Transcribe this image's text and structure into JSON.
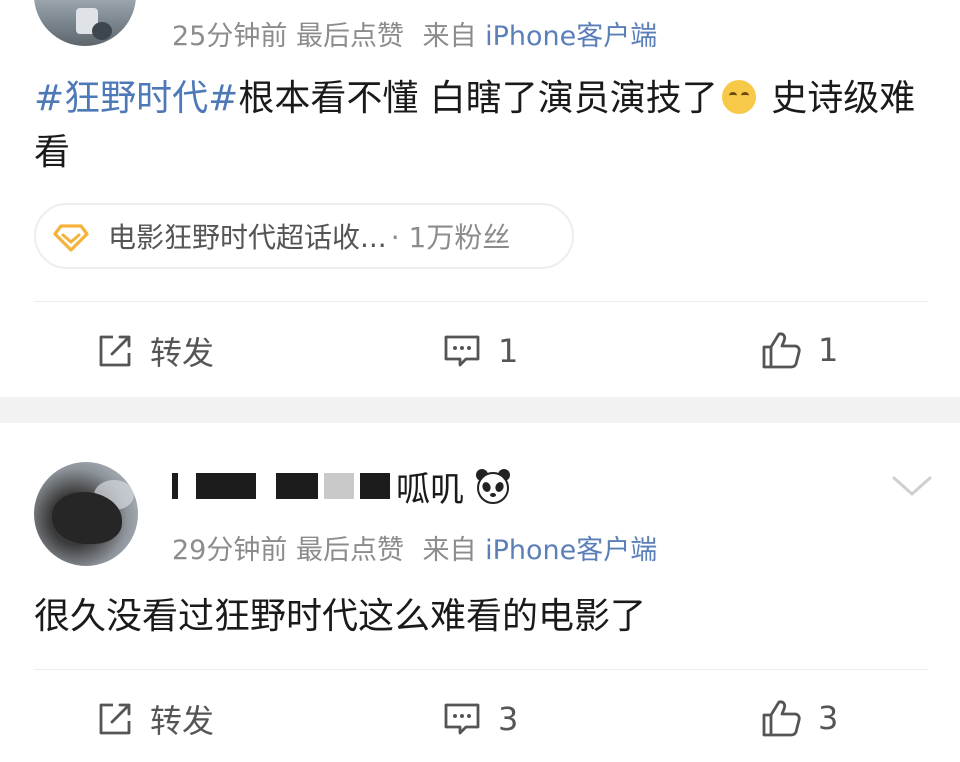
{
  "posts": [
    {
      "meta": {
        "time": "25分钟前",
        "tag": "最后点赞",
        "from_prefix": "来自",
        "source": "iPhone客户端"
      },
      "text": {
        "topic": "#狂野时代#",
        "body_before_emoji": "根本看不懂 白瞎了演员演技了",
        "emoji": "thinking-face-emoji",
        "body_after_emoji": " 史诗级难看"
      },
      "supertopic": {
        "icon": "diamond-icon",
        "name": "电影狂野时代超话收...",
        "fans": "· 1万粉丝"
      },
      "actions": {
        "repost_label": "转发",
        "comment_count": "1",
        "like_count": "1"
      }
    },
    {
      "user": {
        "name_visible_suffix": "呱叽",
        "badge": "panda-emoji"
      },
      "meta": {
        "time": "29分钟前",
        "tag": "最后点赞",
        "from_prefix": "来自",
        "source": "iPhone客户端"
      },
      "text": {
        "body": "很久没看过狂野时代这么难看的电影了"
      },
      "actions": {
        "repost_label": "转发",
        "comment_count": "3",
        "like_count": "3"
      }
    }
  ],
  "colors": {
    "topic_blue": "#4e79b7",
    "source_blue": "#5b7fb8",
    "meta_gray": "#8c8c8c",
    "separator": "#f2f2f2"
  }
}
